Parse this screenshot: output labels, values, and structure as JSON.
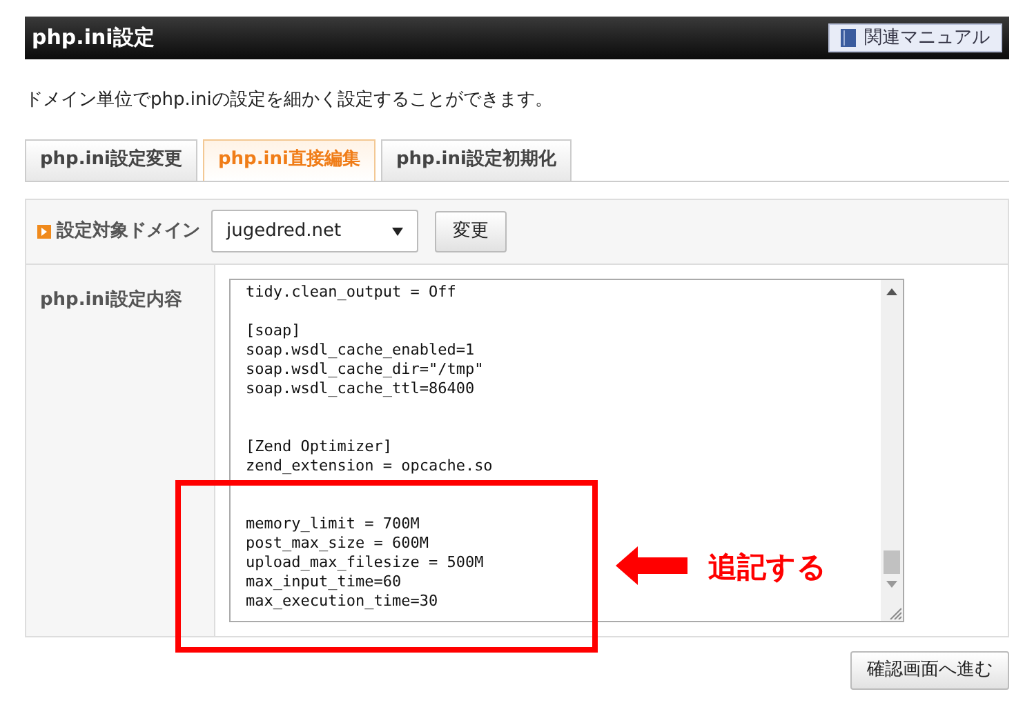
{
  "header": {
    "title": "php.ini設定",
    "manual_button": "関連マニュアル"
  },
  "description": "ドメイン単位でphp.iniの設定を細かく設定することができます。",
  "tabs": [
    {
      "label": "php.ini設定変更",
      "selected": false
    },
    {
      "label": "php.ini直接編集",
      "selected": true
    },
    {
      "label": "php.ini設定初期化",
      "selected": false
    }
  ],
  "domain_row": {
    "label": "設定対象ドメイン",
    "select_value": "jugedred.net",
    "button": "変更"
  },
  "content_row": {
    "label": "php.ini設定内容",
    "text": "tidy.clean_output = Off\n\n[soap]\nsoap.wsdl_cache_enabled=1\nsoap.wsdl_cache_dir=\"/tmp\"\nsoap.wsdl_cache_ttl=86400\n\n\n[Zend Optimizer]\nzend_extension = opcache.so\n\n\nmemory_limit = 700M\npost_max_size = 600M\nupload_max_filesize = 500M\nmax_input_time=60\nmax_execution_time=30"
  },
  "annotation": {
    "text": "追記する"
  },
  "confirm_button": "確認画面へ進む"
}
